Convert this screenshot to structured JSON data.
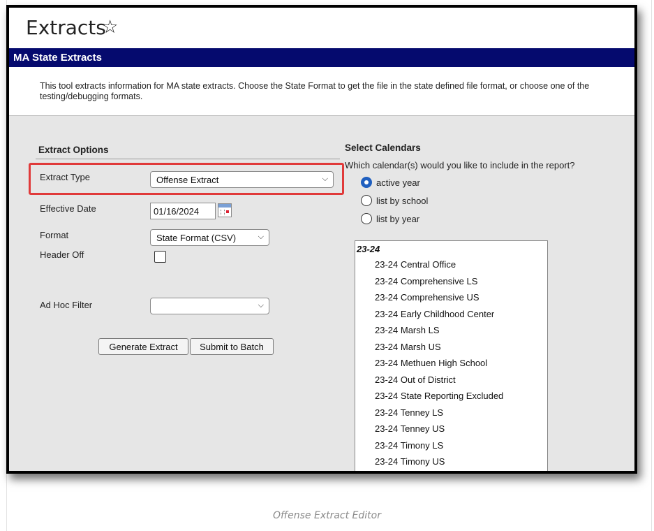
{
  "page": {
    "title": "Extracts",
    "star_glyph": "☆",
    "section_header": "MA State Extracts",
    "description": "This tool extracts information for MA state extracts. Choose the State Format to get the file in the state defined file format, or choose one of the testing/debugging formats.",
    "caption": "Offense Extract Editor"
  },
  "extract_options": {
    "heading": "Extract Options",
    "extract_type_label": "Extract Type",
    "extract_type_value": "Offense Extract",
    "effective_date_label": "Effective Date",
    "effective_date_value": "01/16/2024",
    "format_label": "Format",
    "format_value": "State Format (CSV)",
    "header_off_label": "Header Off",
    "ad_hoc_label": "Ad Hoc Filter",
    "ad_hoc_value": "",
    "generate_button": "Generate Extract",
    "batch_button": "Submit to Batch"
  },
  "calendars": {
    "heading": "Select Calendars",
    "question": "Which calendar(s) would you like to include in the report?",
    "radio_options": [
      {
        "label": "active year",
        "checked": true
      },
      {
        "label": "list by school",
        "checked": false
      },
      {
        "label": "list by year",
        "checked": false
      }
    ],
    "group_label": "23-24",
    "items": [
      "23-24 Central Office",
      "23-24 Comprehensive LS",
      "23-24 Comprehensive US",
      "23-24 Early Childhood Center",
      "23-24 Marsh LS",
      "23-24 Marsh US",
      "23-24 Methuen High School",
      "23-24 Out of District",
      "23-24 State Reporting Excluded",
      "23-24 Tenney LS",
      "23-24 Tenney US",
      "23-24 Timony LS",
      "23-24 Timony US"
    ]
  },
  "colors": {
    "header_bg": "#050a6e",
    "highlight_border": "#e03a3a",
    "radio_selected": "#1f5fbf"
  }
}
